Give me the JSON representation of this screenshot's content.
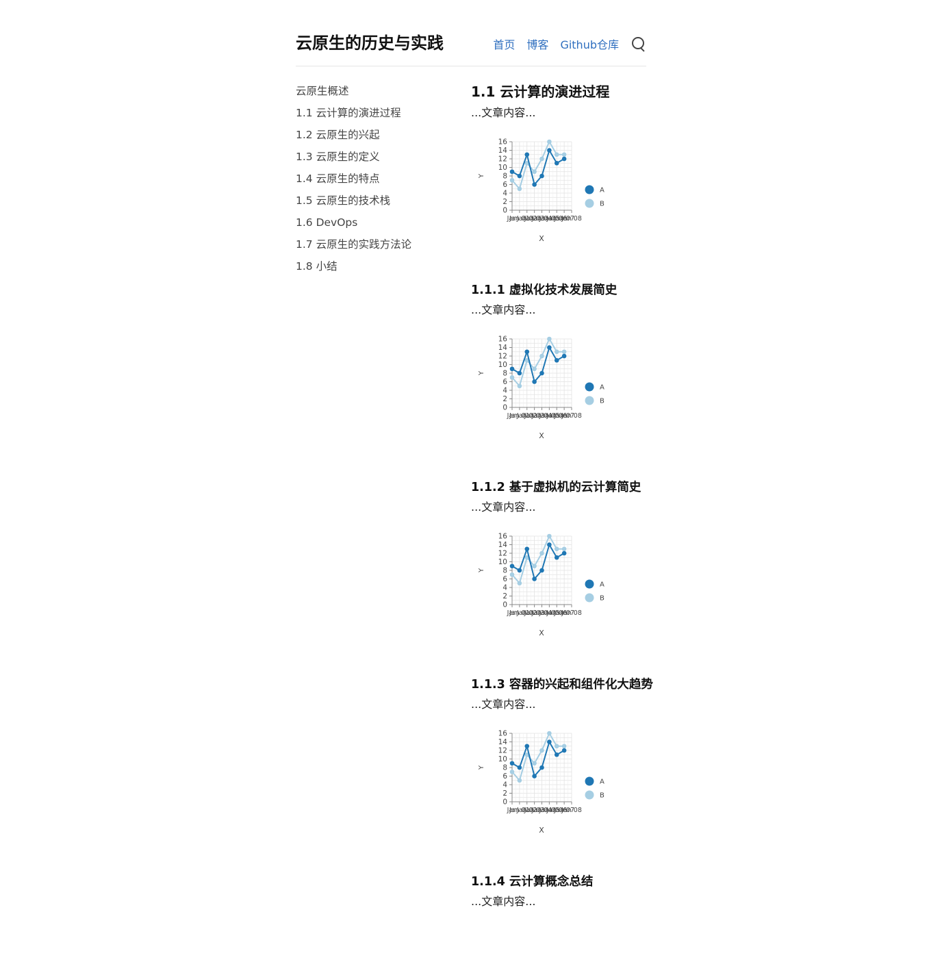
{
  "site": {
    "title": "云原生的历史与实践"
  },
  "nav": {
    "items": [
      "首页",
      "博客",
      "Github仓库"
    ],
    "search_icon": "search-icon"
  },
  "sidebar": {
    "items": [
      "云原生概述",
      "1.1 云计算的演进过程",
      "1.2 云原生的兴起",
      "1.3 云原生的定义",
      "1.4 云原生的特点",
      "1.5 云原生的技术栈",
      "1.6 DevOps",
      "1.7 云原生的实践方法论",
      "1.8 小结"
    ]
  },
  "main": {
    "h2": "1.1 云计算的演进过程",
    "para": "...文章内容...",
    "sections": [
      {
        "heading": "1.1.1 虚拟化技术发展简史",
        "text": "...文章内容..."
      },
      {
        "heading": "1.1.2 基于虚拟机的云计算简史",
        "text": "...文章内容..."
      },
      {
        "heading": "1.1.3 容器的兴起和组件化大趋势",
        "text": "...文章内容..."
      },
      {
        "heading": "1.1.4 云计算概念总结",
        "text": "...文章内容..."
      }
    ]
  },
  "chart_data": [
    {
      "type": "line",
      "xlabel": "X",
      "ylabel": "Y",
      "x": [
        "Jan",
        "Jan 01",
        "Jan 02",
        "Jan 03",
        "Jan 04",
        "Jan 05",
        "Jan 06",
        "Jan 07",
        "Jan 08"
      ],
      "ylim": [
        0,
        16
      ],
      "yticks": [
        "0",
        "2",
        "4",
        "6",
        "8",
        "10",
        "12",
        "14",
        "16"
      ],
      "grid": true,
      "legend": "right",
      "series": [
        {
          "name": "A",
          "color": "#1f77b4",
          "values": [
            9,
            8,
            13,
            6,
            8,
            14,
            11,
            12
          ]
        },
        {
          "name": "B",
          "color": "#a6cee3",
          "values": [
            7,
            5,
            11,
            9,
            12,
            16,
            13,
            13
          ]
        }
      ]
    },
    {
      "type": "line",
      "xlabel": "X",
      "ylabel": "Y",
      "x": [
        "Jan",
        "Jan 01",
        "Jan 02",
        "Jan 03",
        "Jan 04",
        "Jan 05",
        "Jan 06",
        "Jan 07",
        "Jan 08"
      ],
      "ylim": [
        0,
        16
      ],
      "yticks": [
        "0",
        "2",
        "4",
        "6",
        "8",
        "10",
        "12",
        "14",
        "16"
      ],
      "grid": true,
      "legend": "right",
      "series": [
        {
          "name": "A",
          "color": "#1f77b4",
          "values": [
            9,
            8,
            13,
            6,
            8,
            14,
            11,
            12
          ]
        },
        {
          "name": "B",
          "color": "#a6cee3",
          "values": [
            7,
            5,
            11,
            9,
            12,
            16,
            13,
            13
          ]
        }
      ]
    },
    {
      "type": "line",
      "xlabel": "X",
      "ylabel": "Y",
      "x": [
        "Jan",
        "Jan 01",
        "Jan 02",
        "Jan 03",
        "Jan 04",
        "Jan 05",
        "Jan 06",
        "Jan 07",
        "Jan 08"
      ],
      "ylim": [
        0,
        16
      ],
      "yticks": [
        "0",
        "2",
        "4",
        "6",
        "8",
        "10",
        "12",
        "14",
        "16"
      ],
      "grid": true,
      "legend": "right",
      "series": [
        {
          "name": "A",
          "color": "#1f77b4",
          "values": [
            9,
            8,
            13,
            6,
            8,
            14,
            11,
            12
          ]
        },
        {
          "name": "B",
          "color": "#a6cee3",
          "values": [
            7,
            5,
            11,
            9,
            12,
            16,
            13,
            13
          ]
        }
      ]
    },
    {
      "type": "line",
      "xlabel": "X",
      "ylabel": "Y",
      "x": [
        "Jan",
        "Jan 01",
        "Jan 02",
        "Jan 03",
        "Jan 04",
        "Jan 05",
        "Jan 06",
        "Jan 07",
        "Jan 08"
      ],
      "ylim": [
        0,
        16
      ],
      "yticks": [
        "0",
        "2",
        "4",
        "6",
        "8",
        "10",
        "12",
        "14",
        "16"
      ],
      "grid": true,
      "legend": "right",
      "series": [
        {
          "name": "A",
          "color": "#1f77b4",
          "values": [
            9,
            8,
            13,
            6,
            8,
            14,
            11,
            12
          ]
        },
        {
          "name": "B",
          "color": "#a6cee3",
          "values": [
            7,
            5,
            11,
            9,
            12,
            16,
            13,
            13
          ]
        }
      ]
    }
  ]
}
